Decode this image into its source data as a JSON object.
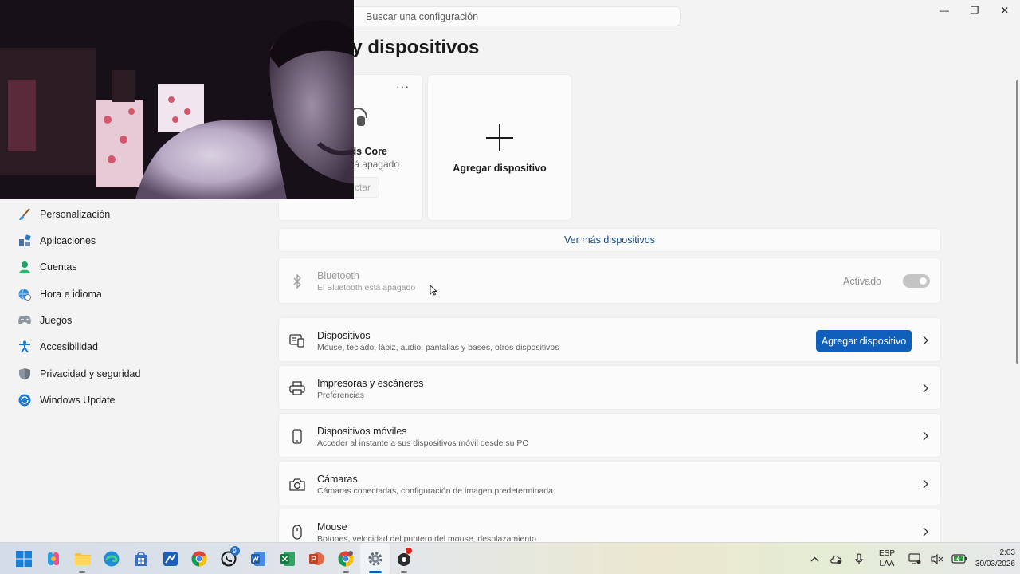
{
  "window": {
    "minimize_glyph": "—",
    "maximize_glyph": "❐",
    "close_glyph": "✕"
  },
  "search": {
    "placeholder": "Buscar una configuración"
  },
  "page": {
    "title": "n y dispositivos"
  },
  "device_card": {
    "more": "···",
    "name": "ds Core",
    "status": "stá apagado",
    "connect_label": "ctar"
  },
  "add_card": {
    "label": "Agregar dispositivo"
  },
  "more_devices_link": "Ver más dispositivos",
  "bluetooth": {
    "title": "Bluetooth",
    "subtitle": "El Bluetooth está apagado",
    "state": "Activado"
  },
  "rows": [
    {
      "title": "Dispositivos",
      "subtitle": "Mouse, teclado, lápiz, audio, pantallas y bases, otros dispositivos",
      "icon": "devices-icon",
      "button": "Agregar dispositivo"
    },
    {
      "title": "Impresoras y escáneres",
      "subtitle": "Preferencias",
      "icon": "printer-icon"
    },
    {
      "title": "Dispositivos móviles",
      "subtitle": "Acceder al instante a sus dispositivos móvil desde su PC",
      "icon": "phone-icon"
    },
    {
      "title": "Cámaras",
      "subtitle": "Cámaras conectadas, configuración de imagen predeterminada",
      "icon": "camera-icon"
    },
    {
      "title": "Mouse",
      "subtitle": "Botones, velocidad del puntero del mouse, desplazamiento",
      "icon": "mouse-icon"
    }
  ],
  "sidebar": {
    "items": [
      {
        "label": "Personalización",
        "icon": "brush-icon"
      },
      {
        "label": "Aplicaciones",
        "icon": "apps-icon"
      },
      {
        "label": "Cuentas",
        "icon": "person-icon"
      },
      {
        "label": "Hora e idioma",
        "icon": "globe-clock-icon"
      },
      {
        "label": "Juegos",
        "icon": "gamepad-icon"
      },
      {
        "label": "Accesibilidad",
        "icon": "accessibility-icon"
      },
      {
        "label": "Privacidad y seguridad",
        "icon": "shield-icon"
      },
      {
        "label": "Windows Update",
        "icon": "update-icon"
      }
    ]
  },
  "taskbar": {
    "apps": [
      {
        "name": "start",
        "icon": "windows-logo-icon"
      },
      {
        "name": "copilot",
        "icon": "copilot-icon"
      },
      {
        "name": "file-explorer",
        "icon": "folder-icon"
      },
      {
        "name": "edge",
        "icon": "edge-icon"
      },
      {
        "name": "store",
        "icon": "store-icon"
      },
      {
        "name": "app-blue",
        "icon": "chart-app-icon"
      },
      {
        "name": "chrome",
        "icon": "chrome-icon"
      },
      {
        "name": "whatsapp",
        "icon": "whatsapp-icon",
        "badge": "9"
      },
      {
        "name": "word",
        "icon": "word-icon"
      },
      {
        "name": "excel",
        "icon": "excel-icon"
      },
      {
        "name": "powerpoint",
        "icon": "powerpoint-icon"
      },
      {
        "name": "chrome-profile",
        "icon": "chrome-profile-icon"
      },
      {
        "name": "settings",
        "icon": "settings-gear-icon"
      },
      {
        "name": "obs",
        "icon": "record-icon"
      }
    ],
    "language": {
      "line1": "ESP",
      "line2": "LAA"
    },
    "clock": {
      "time": "2:03",
      "date": "30/03/2026"
    }
  },
  "colors": {
    "accent": "#1060bb",
    "link": "#14477a",
    "background": "#f3f3f3",
    "card": "#fbfbfb"
  }
}
